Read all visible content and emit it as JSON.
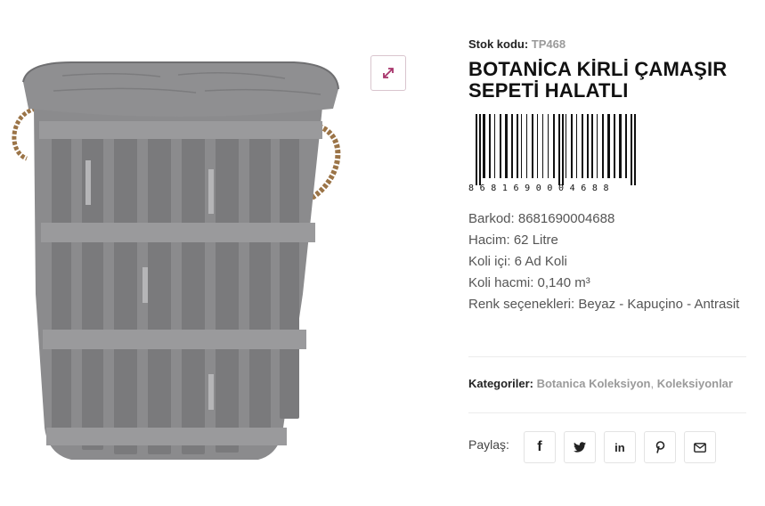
{
  "product": {
    "sku_label": "Stok kodu:",
    "sku_value": "TP468",
    "title": "BOTANİCA KİRLİ ÇAMAŞIR SEPETİ HALATLI",
    "barcode_digits": "8681690004688",
    "specs": [
      "Barkod: 8681690004688",
      "Hacim: 62 Litre",
      "Koli içi: 6 Ad Koli",
      "Koli hacmi: 0,140 m³",
      "Renk seçenekleri: Beyaz - Kapuçino - Antrasit"
    ]
  },
  "categories": {
    "label": "Kategoriler:",
    "items": [
      "Botanica Koleksiyon",
      "Koleksiyonlar"
    ],
    "separator": ","
  },
  "share": {
    "label": "Paylaş:",
    "buttons": [
      {
        "icon": "facebook-icon",
        "glyph": "f"
      },
      {
        "icon": "twitter-icon",
        "glyph": "🐦"
      },
      {
        "icon": "linkedin-icon",
        "glyph": "in"
      },
      {
        "icon": "pinterest-icon",
        "glyph": "P"
      },
      {
        "icon": "envelope-icon",
        "glyph": "✉"
      }
    ]
  },
  "colors": {
    "accent": "#a8346b",
    "basket": "#8a8a8c",
    "rope": "#a07a4a"
  }
}
